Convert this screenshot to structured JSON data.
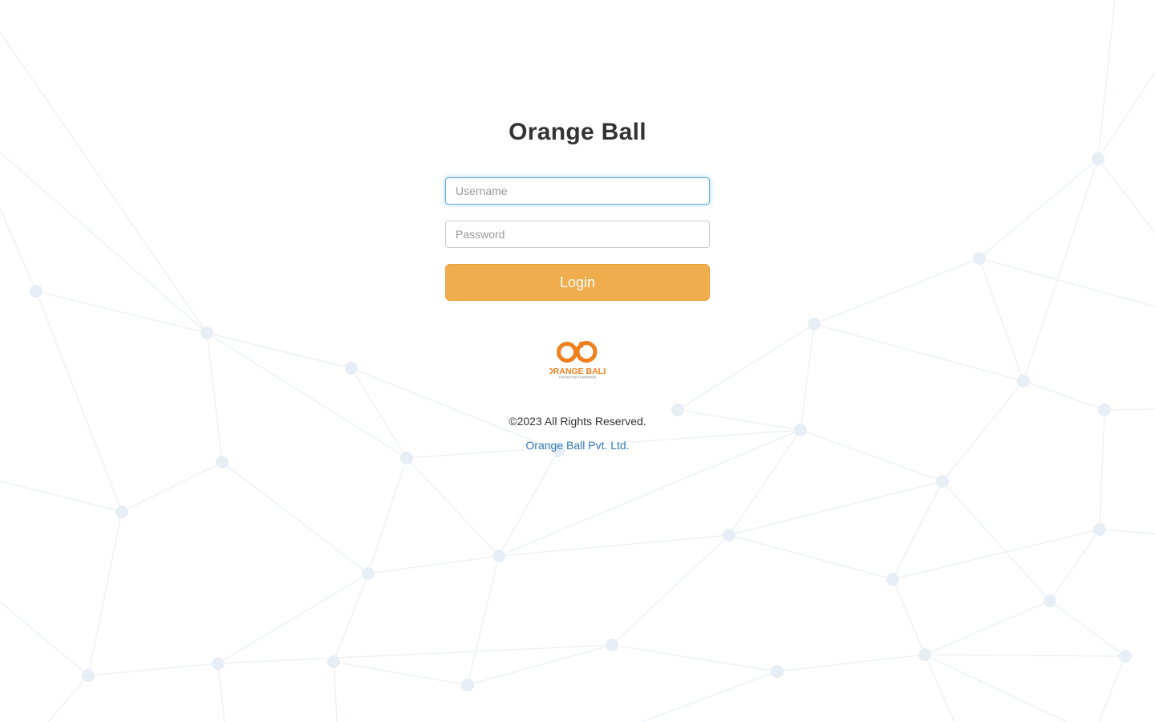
{
  "page": {
    "title": "Orange Ball"
  },
  "form": {
    "username_placeholder": "Username",
    "username_value": "",
    "password_placeholder": "Password",
    "password_value": "",
    "login_label": "Login"
  },
  "logo": {
    "name": "orange-ball-logo",
    "wordmark": "ORANGE BALL",
    "tagline": "FOR BETTER TOMORROW"
  },
  "footer": {
    "copyright": "©2023 All Rights Reserved.",
    "company": "Orange Ball Pvt. Ltd."
  },
  "colors": {
    "accent": "#f0ad4e",
    "brand_orange": "#f07f1d",
    "link": "#337ab7",
    "background_network": "#e8eef5"
  }
}
